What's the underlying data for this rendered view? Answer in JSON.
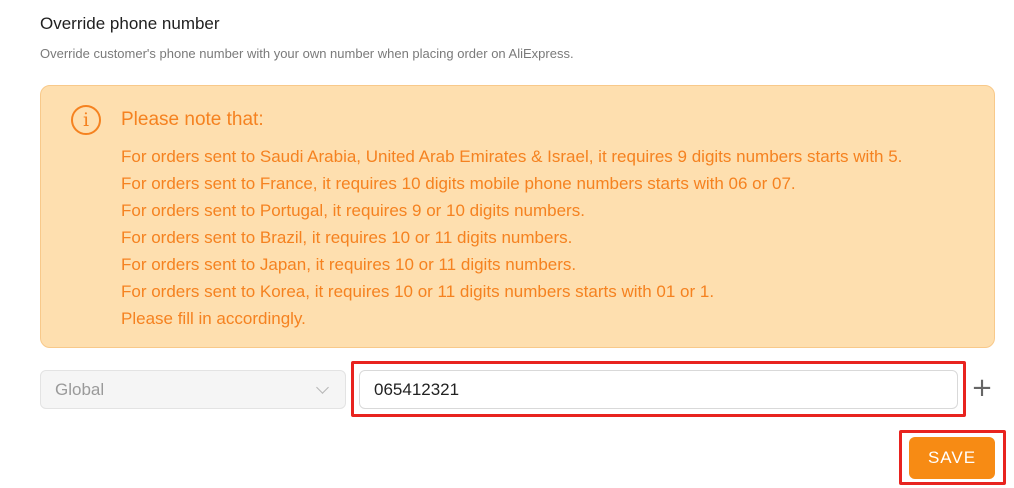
{
  "section": {
    "title": "Override phone number",
    "description": "Override customer's phone number with your own number when placing order on AliExpress."
  },
  "notice": {
    "icon": "info-circle-icon",
    "icon_glyph": "i",
    "heading": "Please note that:",
    "lines": [
      "For orders sent to Saudi Arabia, United Arab Emirates & Israel, it requires 9 digits numbers starts with 5.",
      "For orders sent to France, it requires 10 digits mobile phone numbers starts with 06 or 07.",
      "For orders sent to Portugal, it requires 9 or 10 digits numbers.",
      "For orders sent to Brazil, it requires 10 or 11 digits numbers.",
      "For orders sent to Japan, it requires 10 or 11 digits numbers.",
      "For orders sent to Korea, it requires 10 or 11 digits numbers starts with 01 or 1.",
      "Please fill in accordingly."
    ],
    "colors": {
      "background": "#fedfaf",
      "text": "#f58220",
      "border": "#f8c98a"
    }
  },
  "phone_row": {
    "country_select": {
      "value": "Global",
      "icon": "chevron-down-icon"
    },
    "phone_input": {
      "value": "065412321",
      "placeholder": ""
    },
    "add_button": {
      "label": "+",
      "icon": "plus-icon"
    }
  },
  "actions": {
    "save_label": "SAVE",
    "save_color": "#f78b14"
  },
  "highlight_color": "#e8231f"
}
